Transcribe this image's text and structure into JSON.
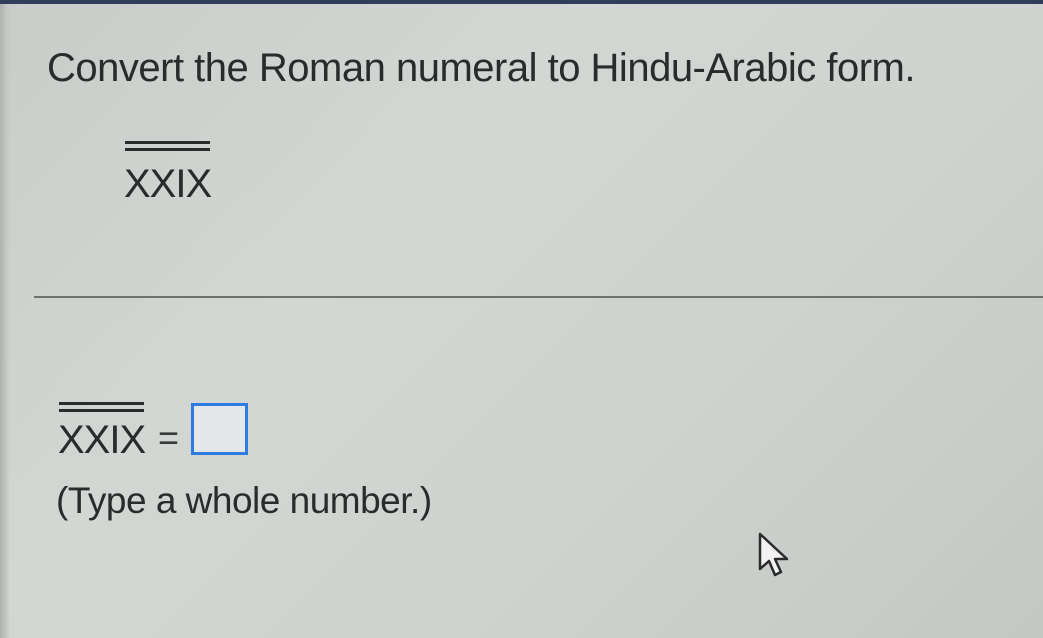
{
  "question": {
    "instruction": "Convert the Roman numeral to Hindu-Arabic form.",
    "numeral": "XXIX"
  },
  "answer": {
    "numeral": "XXIX",
    "equals": "=",
    "input_value": "",
    "hint": "(Type a whole number.)"
  },
  "colors": {
    "input_border": "#2f7be0",
    "top_bar": "#2f3e5a",
    "background": "#cfd3cf"
  },
  "icons": {
    "cursor": "mouse-pointer-icon"
  }
}
